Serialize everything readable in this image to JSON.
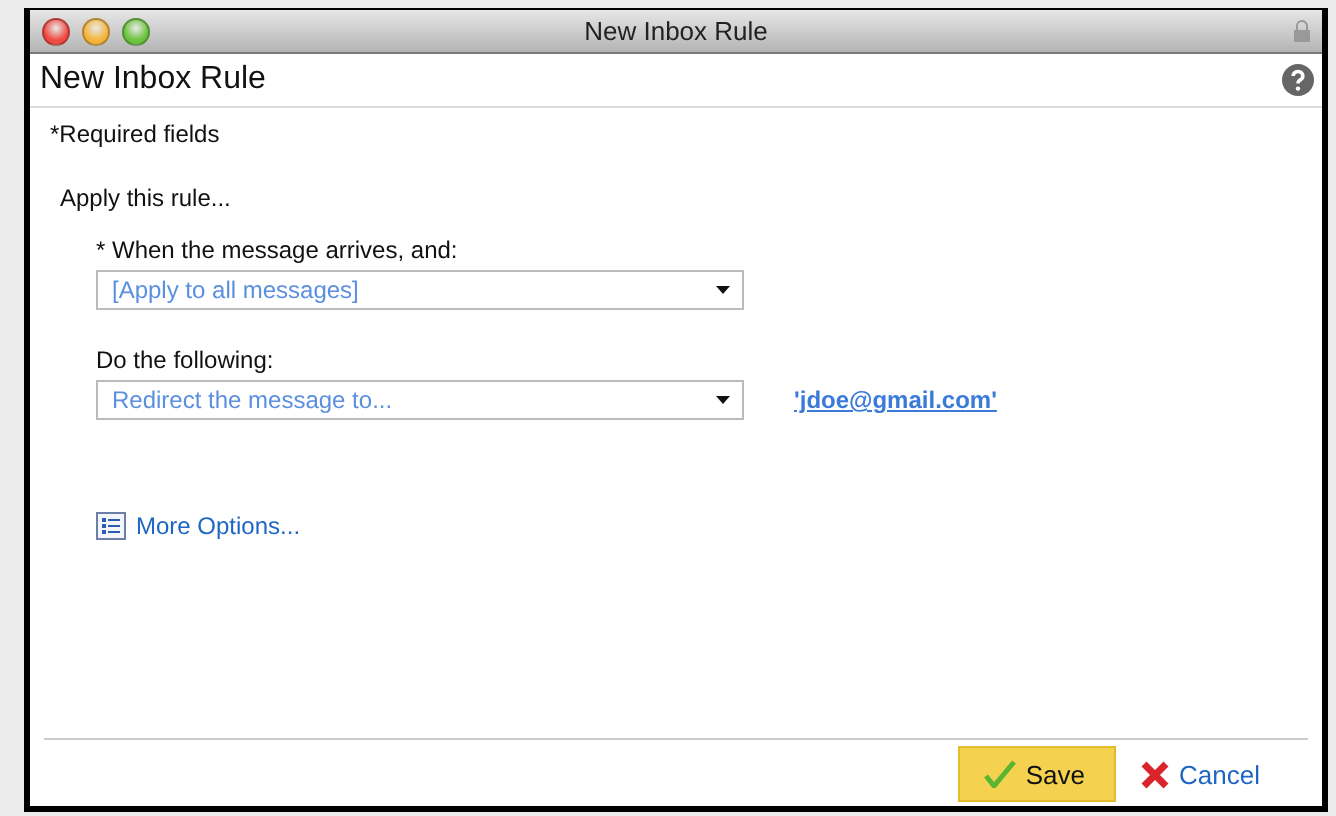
{
  "window": {
    "title": "New Inbox Rule"
  },
  "header": {
    "title": "New Inbox Rule"
  },
  "required_note": "*Required fields",
  "section_title": "Apply this rule...",
  "conditions": [
    {
      "label": "* When the message arrives, and:",
      "value": "[Apply to all messages]"
    },
    {
      "label": "Do the following:",
      "value": "Redirect the message to...",
      "link": "'jdoe@gmail.com'"
    }
  ],
  "more_options": "More Options...",
  "buttons": [
    {
      "kind": "save",
      "label": "Save"
    },
    {
      "kind": "cancel",
      "label": "Cancel"
    }
  ]
}
